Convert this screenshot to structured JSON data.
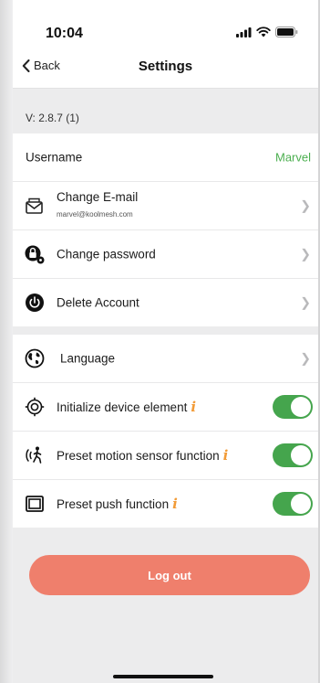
{
  "status_bar": {
    "time": "10:04"
  },
  "nav": {
    "back_label": "Back",
    "title": "Settings"
  },
  "version": "V: 2.8.7 (1)",
  "account": {
    "username_label": "Username",
    "username_value": "Marvel",
    "change_email_label": "Change E-mail",
    "email": "marvel@koolmesh.com",
    "change_password_label": "Change password",
    "delete_account_label": "Delete Account"
  },
  "preferences": {
    "language_label": "Language",
    "initialize_label": "Initialize device element",
    "preset_motion_label": "Preset motion sensor function",
    "preset_push_label": "Preset push function",
    "info_glyph": "i",
    "toggles": {
      "initialize": true,
      "preset_motion": true,
      "preset_push": true
    }
  },
  "logout_label": "Log out",
  "colors": {
    "accent_green": "#45a54d",
    "value_green": "#4caf50",
    "info_orange": "#f29b37",
    "logout": "#ef7f6c"
  },
  "icons": [
    "signal-icon",
    "wifi-icon",
    "battery-icon",
    "back-chevron-icon",
    "mail-icon",
    "lock-gear-icon",
    "power-icon",
    "globe-icon",
    "target-icon",
    "motion-sensor-icon",
    "push-button-icon",
    "chevron-right-icon",
    "info-icon"
  ]
}
